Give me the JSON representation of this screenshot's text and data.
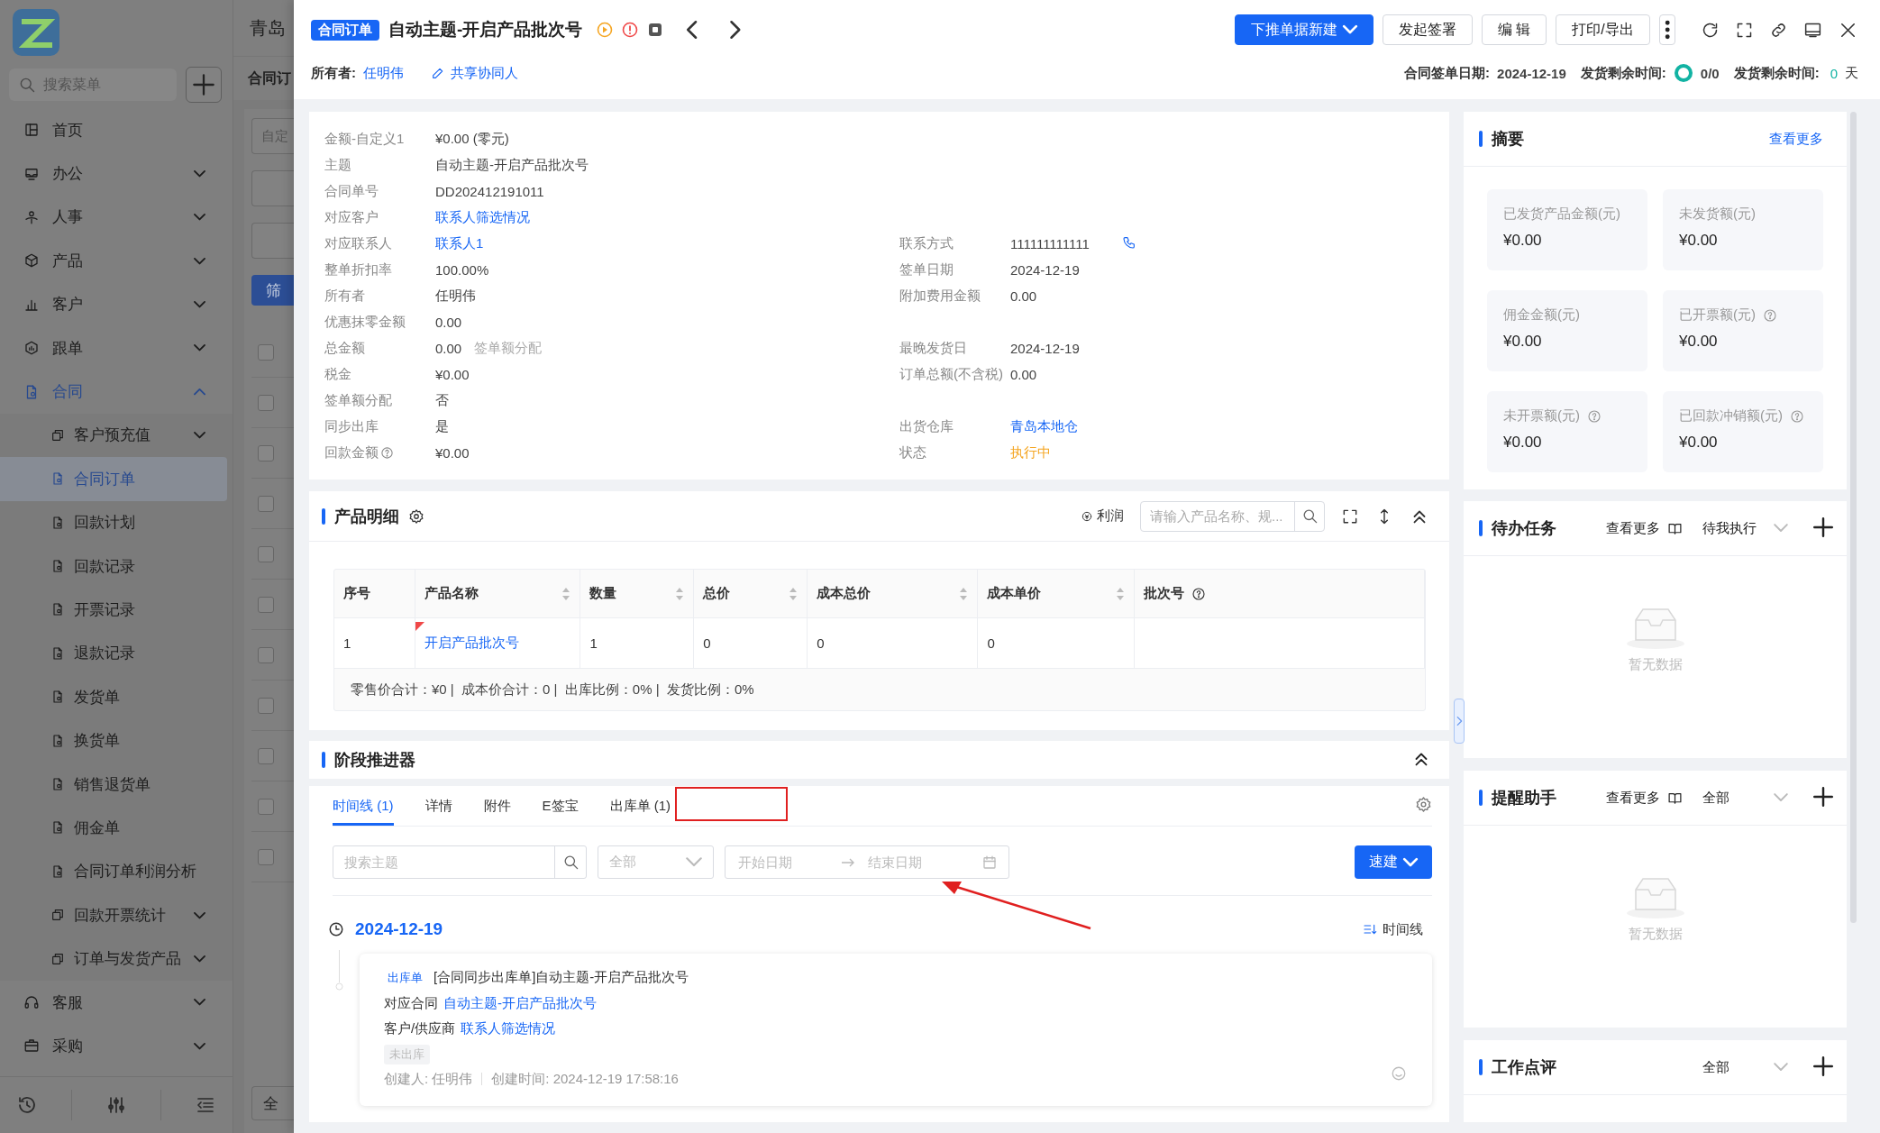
{
  "sidebar": {
    "search_placeholder": "搜索菜单",
    "items": [
      {
        "label": "首页",
        "selected": false
      },
      {
        "label": "办公",
        "selected": false,
        "expanded": false
      },
      {
        "label": "人事",
        "selected": false,
        "expanded": false
      },
      {
        "label": "产品",
        "selected": false,
        "expanded": false
      },
      {
        "label": "客户",
        "selected": false,
        "expanded": false
      },
      {
        "label": "跟单",
        "selected": false,
        "expanded": false
      },
      {
        "label": "合同",
        "selected": false,
        "expanded": true,
        "children": [
          {
            "label": "客户预充值",
            "selected": false,
            "expanded": false
          },
          {
            "label": "合同订单",
            "selected": true
          },
          {
            "label": "回款计划",
            "selected": false
          },
          {
            "label": "回款记录",
            "selected": false
          },
          {
            "label": "开票记录",
            "selected": false
          },
          {
            "label": "退款记录",
            "selected": false
          },
          {
            "label": "发货单",
            "selected": false
          },
          {
            "label": "换货单",
            "selected": false
          },
          {
            "label": "销售退货单",
            "selected": false
          },
          {
            "label": "佣金单",
            "selected": false
          },
          {
            "label": "合同订单利润分析",
            "selected": false
          },
          {
            "label": "回款开票统计",
            "selected": false,
            "expanded": false
          },
          {
            "label": "订单与发货产品",
            "selected": false,
            "expanded": false
          }
        ]
      },
      {
        "label": "客服",
        "selected": false,
        "expanded": false
      },
      {
        "label": "采购",
        "selected": false,
        "expanded": false
      }
    ]
  },
  "background_page": {
    "breadcrumb": "青岛",
    "title": "合同订",
    "filter_placeholder": "自定",
    "filter_button": "筛",
    "all_checked": false,
    "rows": [
      {
        "checked": false
      },
      {
        "checked": false
      },
      {
        "checked": false
      },
      {
        "checked": false
      },
      {
        "checked": false
      },
      {
        "checked": false
      },
      {
        "checked": false
      },
      {
        "checked": false
      },
      {
        "checked": false
      },
      {
        "checked": false
      }
    ],
    "footer": "全"
  },
  "drawer_header": {
    "tag": "合同订单",
    "title": "自动主题-开启产品批次号",
    "buttons": [
      {
        "label": "下推单据新建",
        "kind": "primary",
        "caret": true
      },
      {
        "label": "发起签署",
        "kind": "default",
        "caret": false
      },
      {
        "label": "编 辑",
        "kind": "default",
        "caret": false
      },
      {
        "label": "打印/导出",
        "kind": "default",
        "caret": false
      }
    ],
    "owner_label": "所有者:",
    "owner": "任明伟",
    "share": "共享协同人",
    "sign_date_label": "合同签单日期:",
    "sign_date": "2024-12-19",
    "remaining_label": "发货剩余时间:",
    "ratio": "0/0",
    "remaining_label_2": "发货剩余时间:",
    "remaining_value": "0",
    "remaining_unit": "天"
  },
  "details": {
    "rows": [
      {
        "left": {
          "label": "金额-自定义1",
          "value": "¥0.00 (零元)",
          "kind": "text"
        }
      },
      {
        "left": {
          "label": "主题",
          "value": "自动主题-开启产品批次号",
          "kind": "text"
        }
      },
      {
        "left": {
          "label": "合同单号",
          "value": "DD202412191011",
          "kind": "text"
        }
      },
      {
        "left": {
          "label": "对应客户",
          "value": "联系人筛选情况",
          "kind": "link"
        }
      },
      {
        "left": {
          "label": "对应联系人",
          "value": "联系人1",
          "kind": "link"
        },
        "right": {
          "label": "联系方式",
          "value": "111111111111",
          "kind": "text",
          "phone": true
        }
      },
      {
        "left": {
          "label": "整单折扣率",
          "value": "100.00%",
          "kind": "text"
        },
        "right": {
          "label": "签单日期",
          "value": "2024-12-19",
          "kind": "text"
        }
      },
      {
        "left": {
          "label": "所有者",
          "value": "任明伟",
          "kind": "text"
        },
        "right": {
          "label": "附加费用金额",
          "value": "0.00",
          "kind": "text"
        }
      },
      {
        "left": {
          "label": "优惠抹零金额",
          "value": "0.00",
          "kind": "text"
        }
      },
      {
        "left": {
          "label": "总金额",
          "value": "0.00",
          "kind": "text",
          "note": "签单额分配"
        },
        "right": {
          "label": "最晚发货日",
          "value": "2024-12-19",
          "kind": "text"
        }
      },
      {
        "left": {
          "label": "税金",
          "value": "¥0.00",
          "kind": "text"
        },
        "right": {
          "label": "订单总额(不含税)",
          "value": "0.00",
          "kind": "text"
        }
      },
      {
        "left": {
          "label": "签单额分配",
          "value": "否",
          "kind": "text"
        }
      },
      {
        "left": {
          "label": "同步出库",
          "value": "是",
          "kind": "text"
        },
        "right": {
          "label": "出货仓库",
          "value": "青岛本地仓",
          "kind": "link"
        }
      },
      {
        "left": {
          "label": "回款金额",
          "value": "¥0.00",
          "kind": "text",
          "help": true
        },
        "right": {
          "label": "状态",
          "value": "执行中",
          "kind": "status"
        }
      }
    ]
  },
  "products": {
    "title": "产品明细",
    "profit_label": "利润",
    "search_placeholder": "请输入产品名称、规...",
    "columns": [
      {
        "label": "序号",
        "sortable": false
      },
      {
        "label": "产品名称",
        "sortable": true
      },
      {
        "label": "数量",
        "sortable": true
      },
      {
        "label": "总价",
        "sortable": true
      },
      {
        "label": "成本总价",
        "sortable": true
      },
      {
        "label": "成本单价",
        "sortable": true
      },
      {
        "label": "批次号",
        "sortable": false,
        "help": true
      }
    ],
    "rows": [
      {
        "index": "1",
        "name": "开启产品批次号",
        "quantity": "1",
        "total": "0",
        "cost_total": "0",
        "cost_unit": "0",
        "flagged": true
      }
    ],
    "totals": "零售价合计：¥0 |  成本价合计：0 |  出库比例：0% |  发货比例：0%"
  },
  "stage": {
    "title": "阶段推进器",
    "tabs": [
      {
        "label": "时间线 (1)",
        "selected": true
      },
      {
        "label": "详情",
        "selected": false
      },
      {
        "label": "附件",
        "selected": false
      },
      {
        "label": "E签宝",
        "selected": false
      },
      {
        "label": "出库单 (1)",
        "selected": false
      }
    ],
    "search_placeholder": "搜索主题",
    "type_filter": "全部",
    "start_placeholder": "开始日期",
    "end_placeholder": "结束日期",
    "quick_button": "速建",
    "view_label": "时间线",
    "timeline": [
      {
        "date": "2024-12-19",
        "entries": [
          {
            "tag": "出库单",
            "title": "[合同同步出库单]自动主题-开启产品批次号",
            "contract_label": "对应合同",
            "contract": "自动主题-开启产品批次号",
            "party_label": "客户/供应商",
            "party": "联系人筛选情况",
            "status": "未出库",
            "creator": "创建人: 任明伟",
            "created": "创建时间: 2024-12-19 17:58:16"
          }
        ]
      }
    ]
  },
  "summary": {
    "title": "摘要",
    "more": "查看更多",
    "stats": [
      {
        "label": "已发货产品金额(元)",
        "value": "¥0.00"
      },
      {
        "label": "未发货额(元)",
        "value": "¥0.00"
      },
      {
        "label": "佣金金额(元)",
        "value": "¥0.00"
      },
      {
        "label": "已开票额(元)",
        "value": "¥0.00",
        "help": true
      },
      {
        "label": "未开票额(元)",
        "value": "¥0.00",
        "help": true
      },
      {
        "label": "已回款冲销额(元)",
        "value": "¥0.00",
        "help": true
      }
    ]
  },
  "panels": [
    {
      "title": "待办任务",
      "more": "查看更多",
      "filter": "待我执行",
      "empty": "暂无数据"
    },
    {
      "title": "提醒助手",
      "more": "查看更多",
      "filter": "全部",
      "empty": "暂无数据"
    },
    {
      "title": "工作点评",
      "filter": "全部"
    }
  ]
}
